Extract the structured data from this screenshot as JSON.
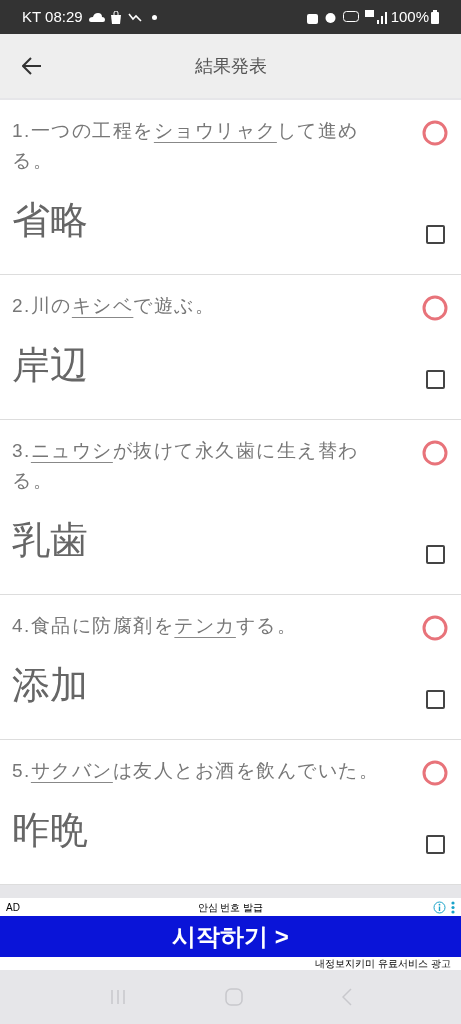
{
  "status_bar": {
    "carrier_time": "KT 08:29",
    "battery": "100%"
  },
  "header": {
    "title": "結果発表"
  },
  "questions": [
    {
      "number": "1.",
      "before": "一つの工程を",
      "underlined": "ショウリャク",
      "after": "して進める。",
      "answer": "省略",
      "kind": "correct",
      "checked": false
    },
    {
      "number": "2.",
      "before": "川の",
      "underlined": "キシベ",
      "after": "で遊ぶ。",
      "answer": "岸辺",
      "kind": "correct",
      "checked": false
    },
    {
      "number": "3.",
      "underlined": "ニュウシ",
      "after": "が抜けて永久歯に生え替わる。",
      "answer": "乳歯",
      "kind": "correct",
      "checked": false
    },
    {
      "number": "4.",
      "before": "食品に防腐剤を",
      "underlined": "テンカ",
      "after": "する。",
      "answer": "添加",
      "kind": "correct",
      "checked": false
    },
    {
      "number": "5.",
      "underlined": "サクバン",
      "after": "は友人とお酒を飲んでいた。",
      "answer": "昨晩",
      "kind": "correct",
      "checked": false
    }
  ],
  "ad": {
    "label": "AD",
    "headline": "안심 번호 발급",
    "button": "시작하기 >",
    "footer": "내정보지키미 유료서비스 광고"
  }
}
